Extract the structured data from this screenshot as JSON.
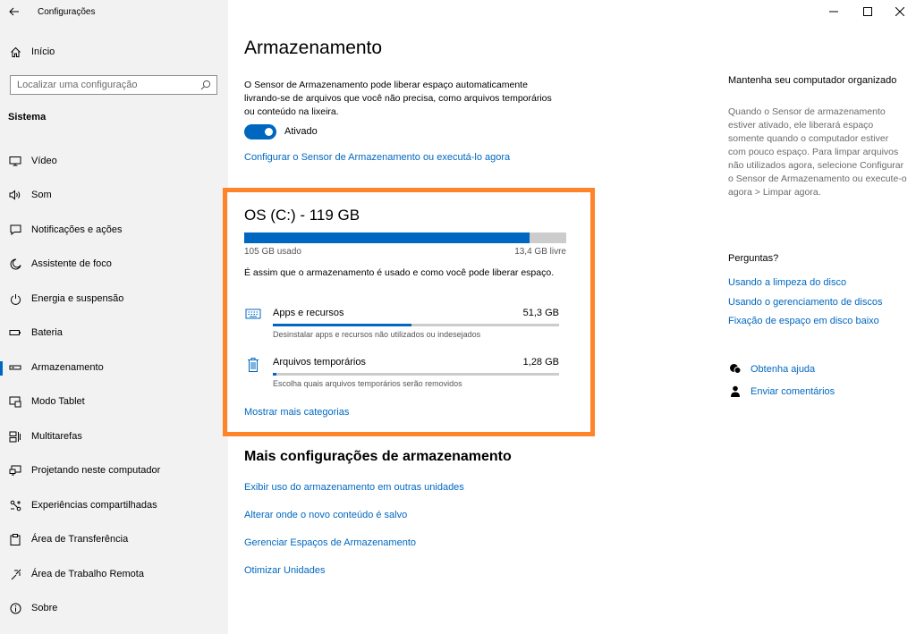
{
  "window": {
    "app_title": "Configurações",
    "controls": {
      "minimize": "—",
      "maximize": "☐",
      "close": "✕"
    }
  },
  "sidebar": {
    "home_label": "Início",
    "search_placeholder": "Localizar uma configuração",
    "section_title": "Sistema",
    "items": [
      {
        "label": "Vídeo",
        "icon": "display-icon"
      },
      {
        "label": "Som",
        "icon": "speaker-icon"
      },
      {
        "label": "Notificações e ações",
        "icon": "notification-icon"
      },
      {
        "label": "Assistente de foco",
        "icon": "moon-icon"
      },
      {
        "label": "Energia e suspensão",
        "icon": "power-icon"
      },
      {
        "label": "Bateria",
        "icon": "battery-icon"
      },
      {
        "label": "Armazenamento",
        "icon": "storage-icon",
        "active": true
      },
      {
        "label": "Modo Tablet",
        "icon": "tablet-icon"
      },
      {
        "label": "Multitarefas",
        "icon": "multitask-icon"
      },
      {
        "label": "Projetando neste computador",
        "icon": "projecting-icon"
      },
      {
        "label": "Experiências compartilhadas",
        "icon": "shared-icon"
      },
      {
        "label": "Área de Transferência",
        "icon": "clipboard-icon"
      },
      {
        "label": "Área de Trabalho Remota",
        "icon": "remote-icon"
      },
      {
        "label": "Sobre",
        "icon": "info-icon"
      }
    ]
  },
  "main": {
    "title": "Armazenamento",
    "description": "O Sensor de Armazenamento pode liberar espaço automaticamente livrando-se de arquivos que você não precisa, como arquivos temporários ou conteúdo na lixeira.",
    "toggle_label": "Ativado",
    "configure_link": "Configurar o Sensor de Armazenamento ou executá-lo agora",
    "drive": {
      "title": "OS (C:) - 119 GB",
      "used_label": "105 GB usado",
      "free_label": "13,4 GB livre",
      "used_fraction": 0.887,
      "usage_description": "É assim que o armazenamento é usado e como você pode liberar espaço."
    },
    "categories": [
      {
        "name": "Apps e recursos",
        "size": "51,3 GB",
        "sub": "Desinstalar apps e recursos não utilizados ou indesejados",
        "fraction": 0.485,
        "icon": "apps-icon"
      },
      {
        "name": "Arquivos temporários",
        "size": "1,28 GB",
        "sub": "Escolha quais arquivos temporários serão removidos",
        "fraction": 0.012,
        "icon": "trash-icon"
      }
    ],
    "show_more": "Mostrar mais categorias",
    "more_title": "Mais configurações de armazenamento",
    "more_links": [
      "Exibir uso do armazenamento em outras unidades",
      "Alterar onde o novo conteúdo é salvo",
      "Gerenciar Espaços de Armazenamento",
      "Otimizar Unidades"
    ]
  },
  "right": {
    "tip_title": "Mantenha seu computador organizado",
    "tip_text": "Quando o Sensor de armazenamento estiver ativado, ele liberará espaço somente quando o computador estiver com pouco espaço. Para limpar arquivos não utilizados agora, selecione Configurar o Sensor de Armazenamento ou execute-o agora > Limpar agora.",
    "questions_title": "Perguntas?",
    "question_links": [
      "Usando a limpeza do disco",
      "Usando o gerenciamento de discos",
      "Fixação de espaço em disco baixo"
    ],
    "help_label": "Obtenha ajuda",
    "feedback_label": "Enviar comentários"
  },
  "colors": {
    "accent": "#0067c0",
    "highlight": "#ff8427",
    "sidebar_bg": "#f2f2f2"
  }
}
